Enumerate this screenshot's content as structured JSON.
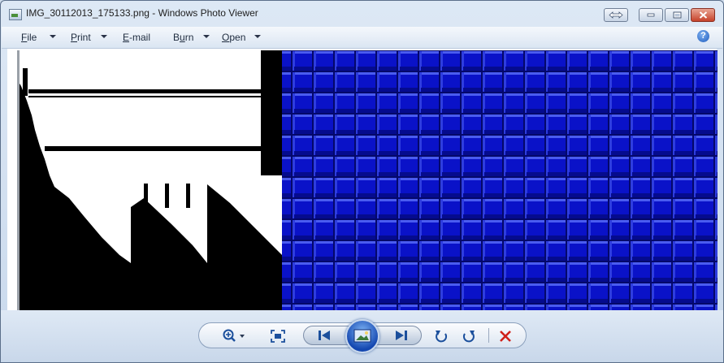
{
  "window": {
    "title": "IMG_30112013_175133.png - Windows Photo Viewer"
  },
  "menubar": {
    "items": [
      {
        "label": "File",
        "underline": "F",
        "rest": "ile"
      },
      {
        "label": "Print",
        "underline": "P",
        "rest": "rint"
      },
      {
        "label": "E-mail",
        "underline": "E",
        "rest": "-mail"
      },
      {
        "label": "Burn",
        "underline": "u",
        "pre": "B",
        "rest": "rn"
      },
      {
        "label": "Open",
        "underline": "O",
        "rest": "pen"
      }
    ]
  },
  "help_glyph": "?",
  "colors": {
    "tile_blue": "#0a12c8",
    "tile_highlight": "#4a5cf0",
    "tile_shadow": "#04086a",
    "title_text": "#1e1e1e",
    "close_red": "#c6422a"
  },
  "icons": {
    "zoom": "zoom-icon",
    "actual_size": "actual-size-icon",
    "previous": "previous-icon",
    "slideshow": "slideshow-icon",
    "next": "next-icon",
    "rotate_ccw": "rotate-counterclockwise-icon",
    "rotate_cw": "rotate-clockwise-icon",
    "delete": "delete-icon"
  }
}
